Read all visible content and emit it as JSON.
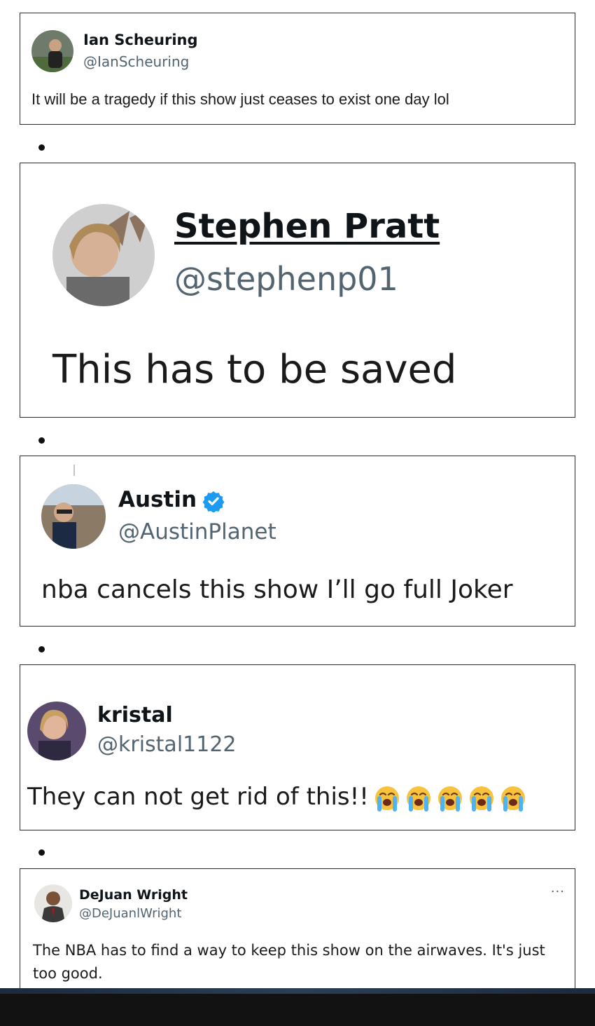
{
  "tweets": [
    {
      "name": "Ian Scheuring",
      "handle": "@IanScheuring",
      "text": "It will be a tragedy if this show just ceases to exist one day lol"
    },
    {
      "name": "Stephen Pratt",
      "handle": "@stephenp01",
      "text": "This has to be saved"
    },
    {
      "name": "Austin",
      "handle": "@AustinPlanet",
      "text": "nba cancels this show I’ll go full Joker",
      "verified": true
    },
    {
      "name": "kristal",
      "handle": "@kristal1122",
      "text": "They can not get rid of this!!",
      "emoji": "loudly-crying-face",
      "emoji_count": 5
    },
    {
      "name": "DeJuan Wright",
      "handle": "@DeJuanlWright",
      "text": "The NBA has to find a way to keep this show on the airwaves. It's just too good.",
      "menu": "···"
    }
  ],
  "colors": {
    "verified_blue": "#1d9bf0",
    "handle_gray": "#536471",
    "border": "#2b2b2b"
  }
}
